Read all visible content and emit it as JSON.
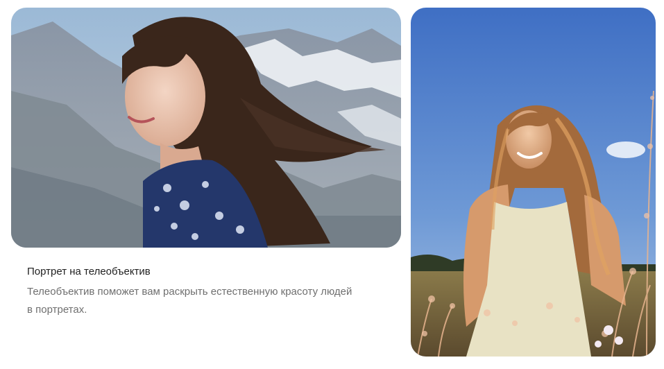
{
  "feature": {
    "title": "Портрет на телеобъектив",
    "description": "Телеобъектив поможет вам раскрыть естественную красоту людей в портретах."
  }
}
